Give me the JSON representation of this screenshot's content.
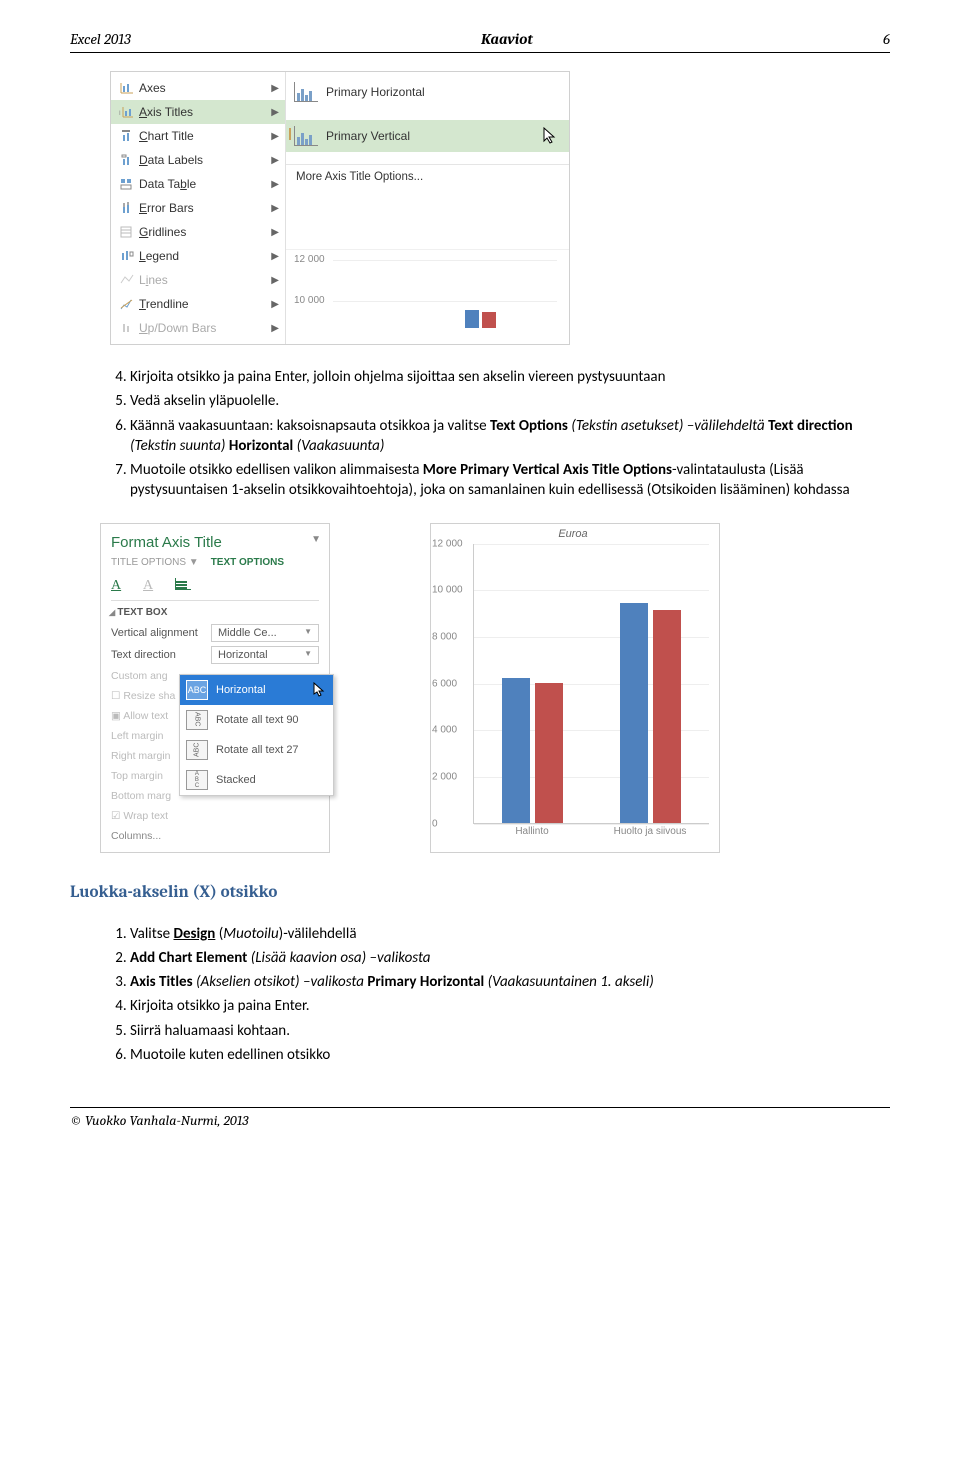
{
  "header": {
    "left": "Excel 2013",
    "center": "Kaaviot",
    "page": "6"
  },
  "menu": {
    "items": [
      {
        "label": "Axes"
      },
      {
        "label": "Axis Titles",
        "selected": true
      },
      {
        "label": "Chart Title"
      },
      {
        "label": "Data Labels"
      },
      {
        "label": "Data Table"
      },
      {
        "label": "Error Bars"
      },
      {
        "label": "Gridlines"
      },
      {
        "label": "Legend"
      },
      {
        "label": "Lines",
        "disabled": true
      },
      {
        "label": "Trendline"
      },
      {
        "label": "Up/Down Bars",
        "disabled": true
      }
    ],
    "submenu": {
      "opt1": "Primary Horizontal",
      "opt2": "Primary Vertical",
      "more": "More Axis Title Options..."
    },
    "peek": {
      "y1": "12 000",
      "y2": "10 000"
    }
  },
  "body1": {
    "li4": "Kirjoita otsikko ja paina Enter, jolloin ohjelma sijoittaa sen akselin viereen pystysuuntaan",
    "li5": "Vedä akselin yläpuolelle.",
    "li6_pre": "Käännä vaakasuuntaan: kaksoisnapsauta otsikkoa ja valitse ",
    "li6_b1": "Text Options",
    "li6_p1": " (Tekstin asetukset) –välilehdeltä ",
    "li6_b2": "Text direction",
    "li6_p2": " (Tekstin suunta) ",
    "li6_b3": "Horizontal",
    "li6_p3": " ",
    "li6_i3": "(Vaakasuunta)",
    "li7_pre": "Muotoile otsikko edellisen valikon alimmaisesta ",
    "li7_b1": "More Primary Vertical  Axis Title Options",
    "li7_post": "-valintataulusta (Lisää pystysuuntaisen 1-akselin otsikkovaihtoehtoja), joka on samanlainen kuin edellisessä (Otsikoiden lisääminen)  kohdassa"
  },
  "panel": {
    "title": "Format Axis Title",
    "tab1": "TITLE OPTIONS ▼",
    "tab2": "TEXT OPTIONS",
    "section": "TEXT BOX",
    "fields": [
      {
        "lbl": "Vertical alignment",
        "val": "Middle Ce..."
      },
      {
        "lbl": "Text direction",
        "val": "Horizontal"
      }
    ],
    "hidden_lines": [
      "Custom ang",
      "Resize sha",
      "Allow text",
      "Left margin",
      "Right margin",
      "Top margin",
      "Bottom marg",
      "Wrap text",
      "Columns..."
    ],
    "dropdown": [
      {
        "label": "Horizontal",
        "ic": "ABC",
        "selected": true
      },
      {
        "label": "Rotate all text 90",
        "ic": "ABC"
      },
      {
        "label": "Rotate all text 27",
        "ic": "ABC"
      },
      {
        "label": "Stacked",
        "ic": "A B C"
      }
    ]
  },
  "chart_data": {
    "type": "bar",
    "title": "Euroa",
    "ylim": [
      0,
      12000
    ],
    "yticks": [
      0,
      2000,
      4000,
      6000,
      8000,
      10000,
      12000
    ],
    "ytick_labels": [
      "0",
      "2 000",
      "4 000",
      "6 000",
      "8 000",
      "10 000",
      "12 000"
    ],
    "categories": [
      "Hallinto",
      "Huolto ja siivous"
    ],
    "series": [
      {
        "name": "blue",
        "color": "#4f81bd",
        "values": [
          6200,
          9400
        ]
      },
      {
        "name": "red",
        "color": "#c0504d",
        "values": [
          6000,
          9100
        ]
      }
    ]
  },
  "heading": "Luokka-akselin (X) otsikko",
  "body2": {
    "li1_a": "Valitse ",
    "li1_b": "Design",
    "li1_c": " (",
    "li1_i": "Muotoilu",
    "li1_d": ")-välilehdellä",
    "li2_a": " ",
    "li2_b": "Add Chart Element",
    "li2_c": " (Lisää kaavion osa) –valikosta",
    "li3_a": "",
    "li3_b": "Axis Titles",
    "li3_c": "  (Akselien otsikot) –valikosta ",
    "li3_b2": "Primary Horizontal",
    "li3_i": " (Vaakasuuntainen 1. akseli)",
    "li4": "Kirjoita otsikko ja paina Enter.",
    "li5": "Siirrä haluamaasi kohtaan.",
    "li6": "Muotoile kuten edellinen otsikko"
  },
  "footer": "© Vuokko Vanhala-Nurmi, 2013"
}
